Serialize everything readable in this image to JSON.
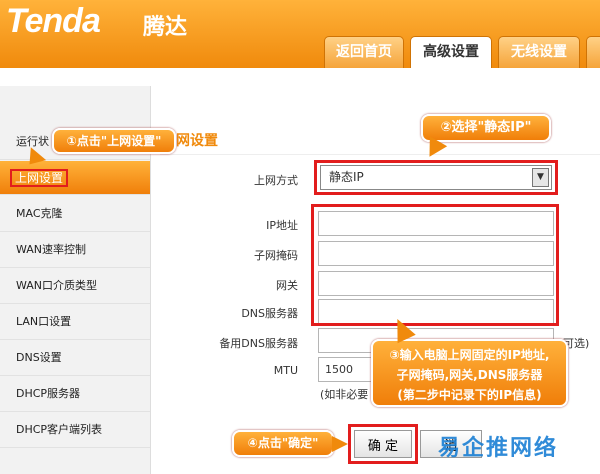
{
  "brand": {
    "logo": "Tenda",
    "logo_cn": "腾达"
  },
  "tabs": [
    {
      "label": "返回首页",
      "active": false
    },
    {
      "label": "高级设置",
      "active": true
    },
    {
      "label": "无线设置",
      "active": false
    }
  ],
  "sidebar": {
    "items": [
      {
        "label": "运行状"
      },
      {
        "label": "上网设置",
        "active": true
      },
      {
        "label": "MAC克隆"
      },
      {
        "label": "WAN速率控制"
      },
      {
        "label": "WAN口介质类型"
      },
      {
        "label": "LAN口设置"
      },
      {
        "label": "DNS设置"
      },
      {
        "label": "DHCP服务器"
      },
      {
        "label": "DHCP客户端列表"
      }
    ]
  },
  "main": {
    "section_title": "网设置",
    "connection_type": {
      "label": "上网方式",
      "value": "静态IP"
    },
    "fields": [
      {
        "label": "IP地址",
        "value": ""
      },
      {
        "label": "子网掩码",
        "value": ""
      },
      {
        "label": "网关",
        "value": ""
      },
      {
        "label": "DNS服务器",
        "value": ""
      },
      {
        "label": "备用DNS服务器",
        "value": "",
        "suffix": "可选)"
      }
    ],
    "mtu": {
      "label": "MTU",
      "value": "1500",
      "note": "(如非必要"
    },
    "ok_label": "确 定",
    "cancel_label": "消"
  },
  "callouts": {
    "step1": "①点击\"上网设置\"",
    "step2": "②选择\"静态IP\"",
    "step3_line1": "③输入电脑上网固定的IP地址,",
    "step3_line2": "子网掩码,网关,DNS服务器",
    "step3_line3": "(第二步中记录下的IP信息)",
    "step4": "④点击\"确定\""
  },
  "watermark": "易企推网络",
  "colors": {
    "brand_orange": "#f08a0c",
    "highlight_red": "#e21d1d",
    "watermark_blue": "#1a7fd4"
  }
}
